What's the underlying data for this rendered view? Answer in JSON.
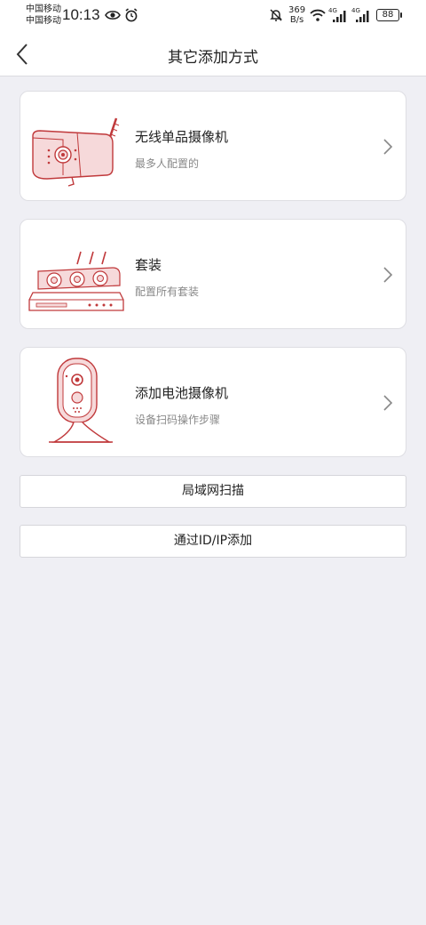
{
  "status_bar": {
    "carrier_1": "中国移动",
    "carrier_2": "中国移动",
    "time": "10:13",
    "net_speed_value": "369",
    "net_speed_unit": "B/s",
    "signal_tag_1": "4G",
    "signal_tag_2": "4G",
    "battery": "88",
    "icons": [
      "eye-icon",
      "alarm-icon",
      "mute-bell-icon",
      "wifi-icon",
      "signal-icon",
      "battery-icon"
    ]
  },
  "nav": {
    "title": "其它添加方式",
    "back_icon": "chevron-left-icon"
  },
  "options": [
    {
      "title": "无线单品摄像机",
      "subtitle": "最多人配置的",
      "icon": "bullet-camera-icon"
    },
    {
      "title": "套装",
      "subtitle": "配置所有套装",
      "icon": "nvr-kit-icon"
    },
    {
      "title": "添加电池摄像机",
      "subtitle": "设备扫码操作步骤",
      "icon": "battery-camera-icon"
    }
  ],
  "buttons": {
    "lan_scan": "局域网扫描",
    "add_by_id": "通过ID/IP添加"
  },
  "colors": {
    "background": "#efeff4",
    "accent_illustration": "#c0393b",
    "illustration_fill": "#f6d9da"
  }
}
